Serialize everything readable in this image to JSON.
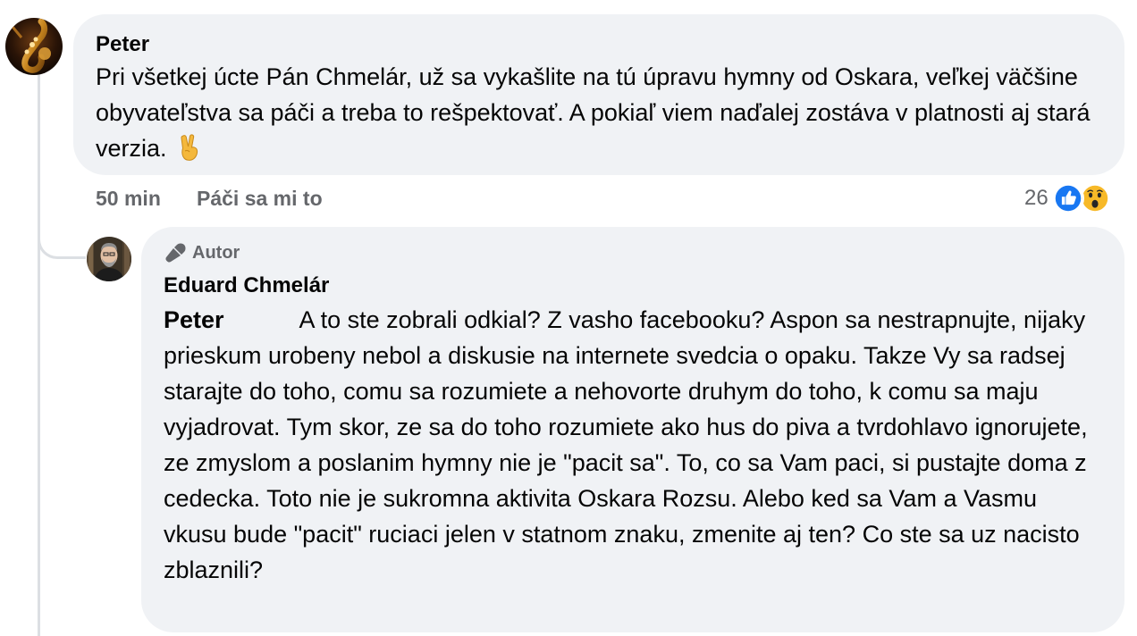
{
  "comment": {
    "author": "Peter",
    "text": "Pri všetkej úcte Pán Chmelár, už sa vykašlite na tú úpravu hymny od Oskara, veľkej väčšine obyvateľstva sa páči a treba to rešpektovať. A pokiaľ viem naďalej zostáva v platnosti aj stará verzia.",
    "emoji": "victory-hand",
    "time": "50 min",
    "like_label": "Páči sa mi to",
    "reaction_count": "26",
    "reactions": [
      "like",
      "wow"
    ]
  },
  "reply": {
    "badge_label": "Autor",
    "badge_icon": "microphone-icon",
    "author": "Eduard Chmelár",
    "mention": "Peter",
    "text": "A to ste zobrali odkial? Z vasho facebooku? Aspon sa nestrapnujte, nijaky prieskum urobeny nebol a diskusie na internete svedcia o opaku. Takze Vy sa radsej starajte do toho, comu sa rozumiete a nehovorte druhym do toho, k comu sa maju vyjadrovat. Tym skor, ze sa do toho rozumiete ako hus do piva a tvrdohlavo ignorujete, ze zmyslom a poslanim hymny nie je \"pacit sa\". To, co sa Vam paci, si pustajte doma z cedecka. Toto nie je sukromna aktivita Oskara Rozsu. Alebo ked sa Vam a Vasmu vkusu bude \"pacit\" ruciaci jelen v statnom znaku, zmenite aj ten? Co ste sa uz nacisto zblaznili?"
  },
  "colors": {
    "bubble": "#f0f2f5",
    "meta_text": "#65676b",
    "like_blue": "#1877f2",
    "wow_yellow": "#f7b928",
    "thread_line": "#dcdfe3"
  }
}
